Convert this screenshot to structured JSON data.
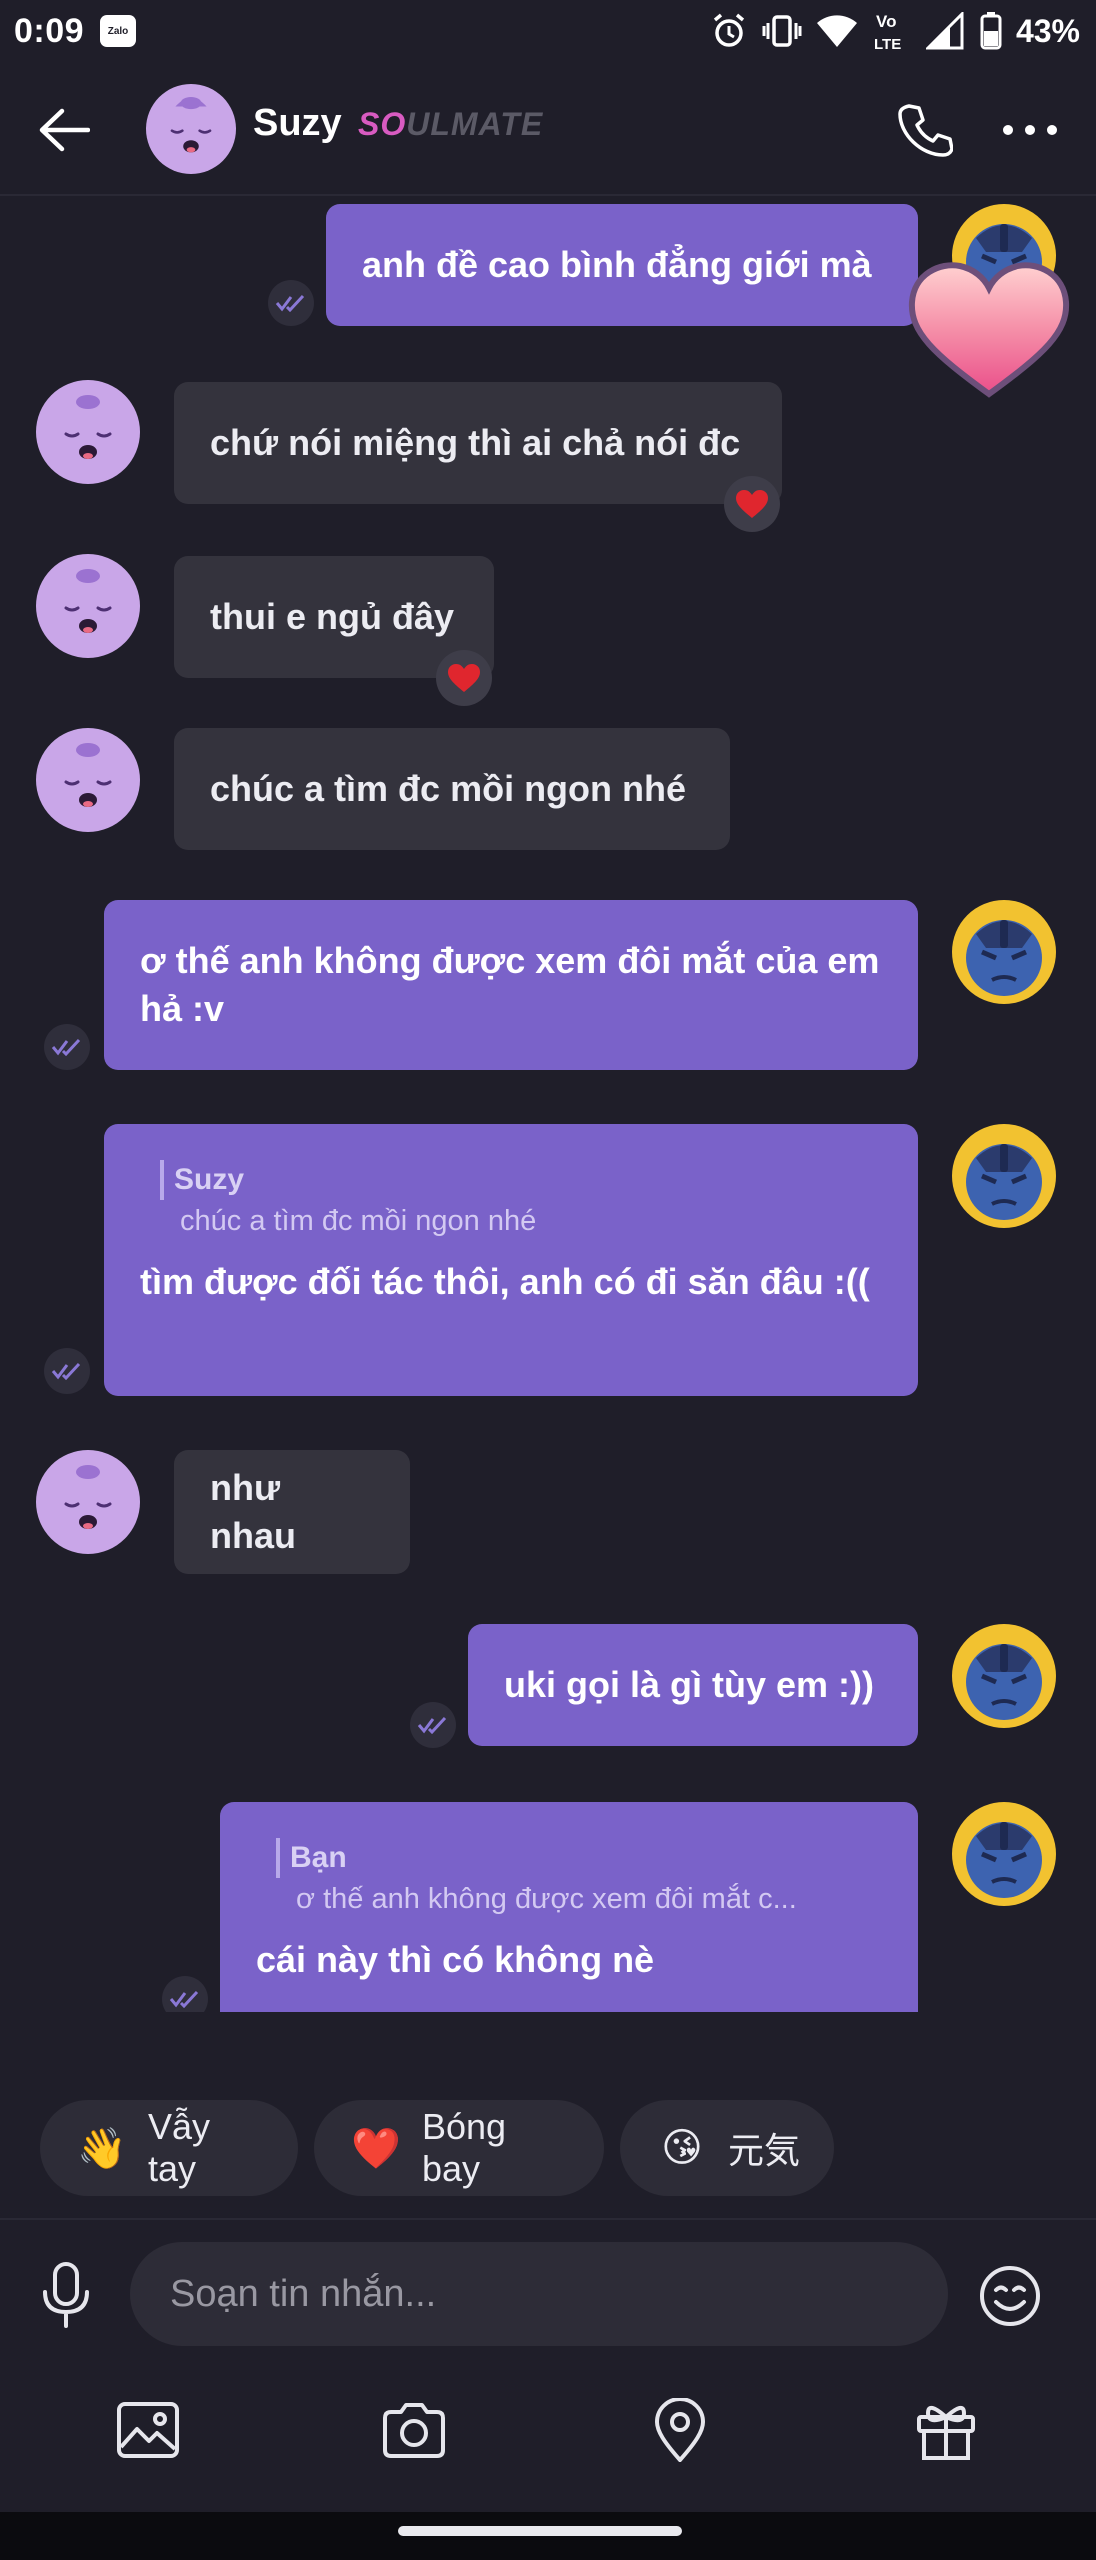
{
  "status_bar": {
    "time": "0:09",
    "notification_app": "Zalo",
    "network_label": "Vo LTE",
    "battery": "43%",
    "icons": [
      "alarm-icon",
      "vibrate-icon",
      "wifi-icon",
      "volte-icon",
      "signal-icon",
      "battery-icon"
    ]
  },
  "header": {
    "contact_name": "Suzy",
    "badge_part1": "SO",
    "badge_part2": "ULMATE",
    "icons": [
      "back-arrow-icon",
      "phone-icon",
      "more-dots-icon"
    ]
  },
  "messages": [
    {
      "direction": "out",
      "text": "anh đề cao bình đẳng giới mà",
      "status": "read",
      "reaction": "big-heart"
    },
    {
      "direction": "in",
      "text": "chứ nói miệng thì ai chả nói đc",
      "reaction": "heart"
    },
    {
      "direction": "in",
      "text": "thui e ngủ đây",
      "reaction": "heart"
    },
    {
      "direction": "in",
      "text": "chúc a tìm đc mồi ngon nhé"
    },
    {
      "direction": "out",
      "text": "ơ thế anh không được xem đôi mắt của em hả :v",
      "status": "read"
    },
    {
      "direction": "out",
      "quote_name": "Suzy",
      "quote_text": "chúc a tìm đc mồi ngon nhé",
      "text": "tìm được đối tác thôi, anh có đi săn đâu :((",
      "status": "read"
    },
    {
      "direction": "in",
      "text": "như nhau"
    },
    {
      "direction": "out",
      "text": "uki gọi là gì tùy em :))",
      "status": "read"
    },
    {
      "direction": "out",
      "quote_name": "Bạn",
      "quote_text": "ơ thế anh không được xem đôi mắt c...",
      "text": "cái này thì có không nè",
      "status": "read"
    }
  ],
  "quick_replies": [
    {
      "emoji": "👋",
      "label": "Vẫy tay"
    },
    {
      "emoji": "❤️",
      "label": "Bóng bay"
    },
    {
      "emoji": "😘",
      "label": "元気"
    }
  ],
  "composer": {
    "placeholder": "Soạn tin nhắn...",
    "icons": [
      "microphone-icon",
      "emoji-icon"
    ]
  },
  "toolbar": {
    "icons": [
      "image-icon",
      "camera-icon",
      "location-icon",
      "gift-icon"
    ]
  },
  "colors": {
    "background": "#1f1e29",
    "outgoing_bubble": "#7a62c9",
    "incoming_bubble": "#34333d",
    "badge_pink": "#d85bc1",
    "avatar_lavender": "#c9a6e8",
    "avatar_user_yellow": "#f2c230",
    "avatar_user_blue": "#3d63b0"
  }
}
